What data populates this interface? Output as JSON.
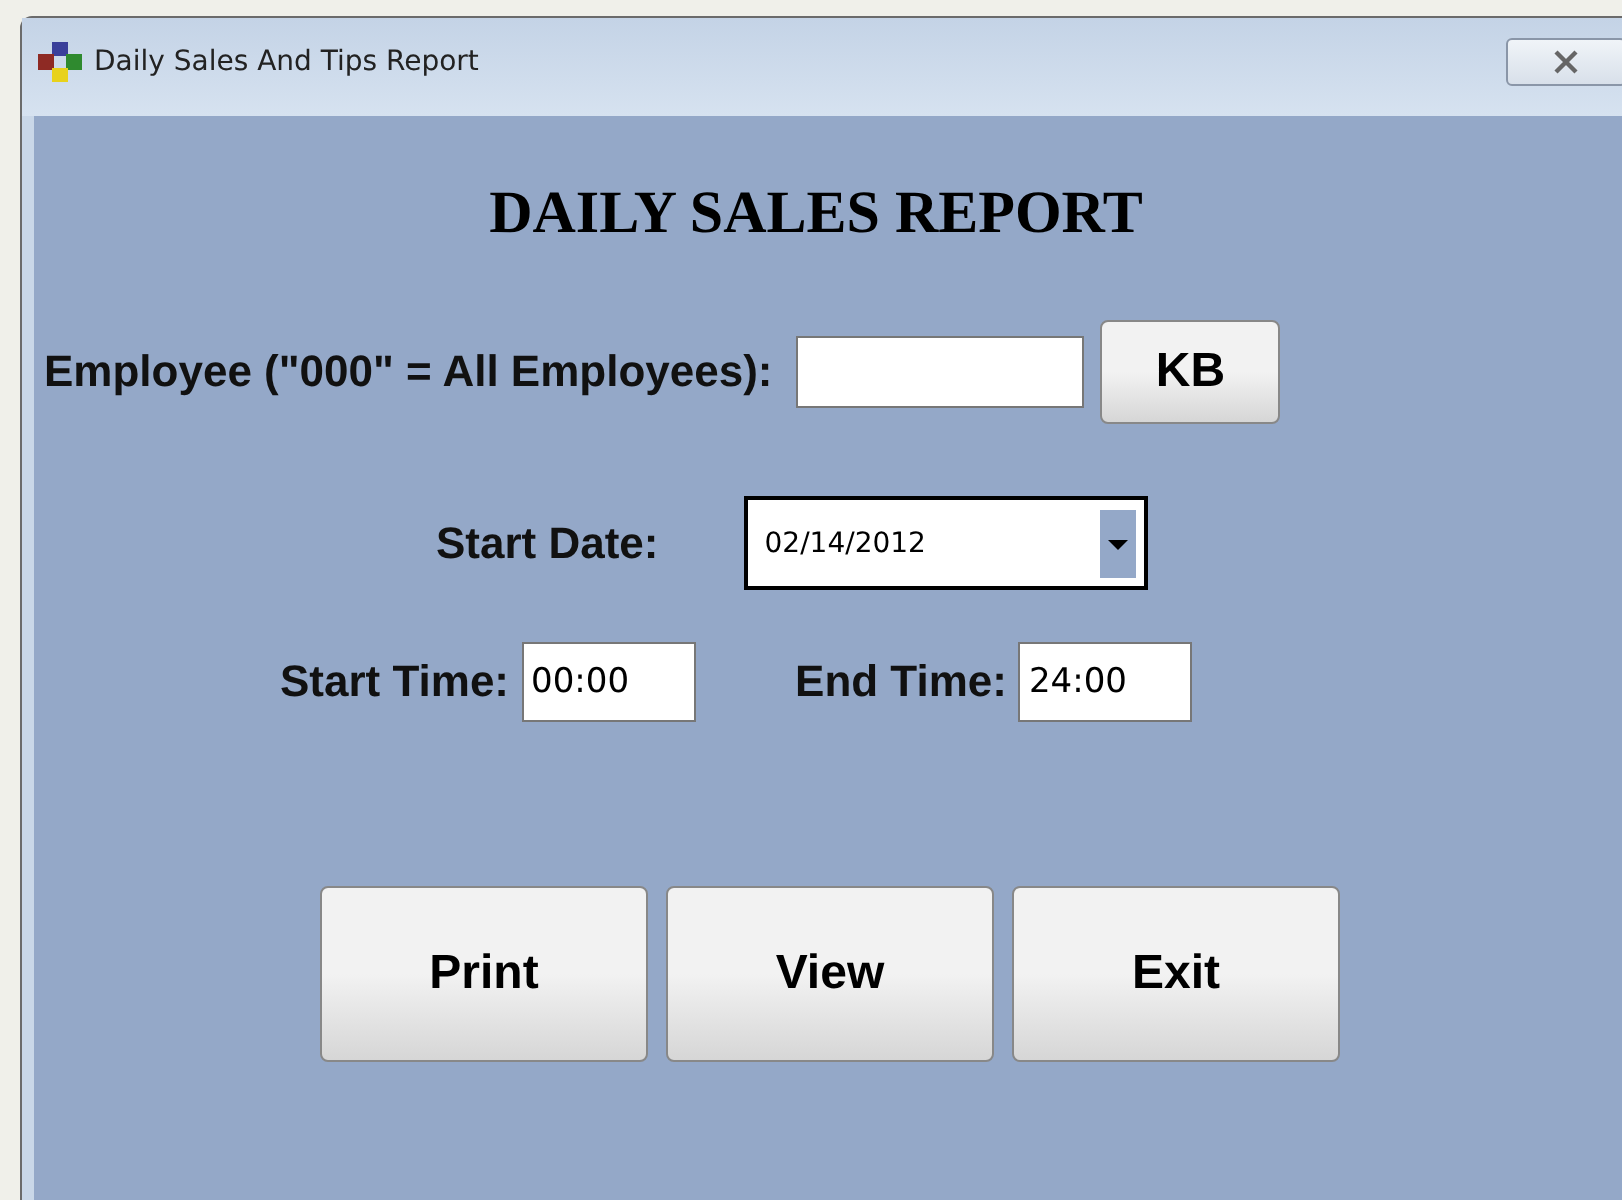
{
  "window": {
    "title": "Daily Sales And Tips Report"
  },
  "heading": "DAILY SALES REPORT",
  "employee": {
    "label": "Employee (\"000\" = All Employees):",
    "keyboard_button": "KB"
  },
  "start_date": {
    "label": "Start Date:",
    "value": "02/14/2012"
  },
  "start_time": {
    "label": "Start Time:",
    "value": "00:00"
  },
  "end_time": {
    "label": "End Time:",
    "value": "24:00"
  },
  "buttons": [
    "Print",
    "View",
    "Exit"
  ]
}
